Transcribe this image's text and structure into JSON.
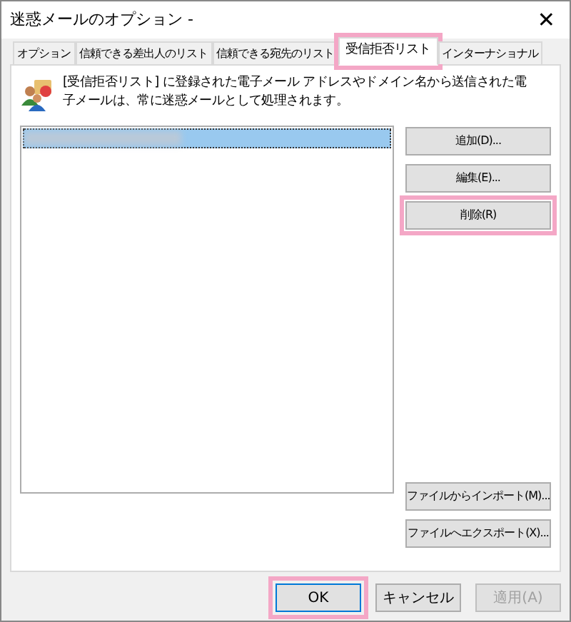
{
  "window": {
    "title": "迷惑メールのオプション -",
    "close": "✕"
  },
  "tabs": [
    {
      "label": "オプション",
      "selected": false,
      "highlighted": false
    },
    {
      "label": "信頼できる差出人のリスト",
      "selected": false,
      "highlighted": false
    },
    {
      "label": "信頼できる宛先のリスト",
      "selected": false,
      "highlighted": false
    },
    {
      "label": "受信拒否リスト",
      "selected": true,
      "highlighted": true
    },
    {
      "label": "インターナショナル",
      "selected": false,
      "highlighted": false
    }
  ],
  "description": "[受信拒否リスト] に登録された電子メール アドレスやドメイン名から送信された電子メールは、常に迷惑メールとして処理されます。",
  "list": {
    "items": [
      {
        "selected": true
      }
    ]
  },
  "side_buttons": [
    {
      "label": "追加(D)...",
      "highlighted": false
    },
    {
      "label": "編集(E)...",
      "highlighted": false
    },
    {
      "label": "削除(R)",
      "highlighted": true
    },
    {
      "label": "ファイルからインポート(M)...",
      "highlighted": false
    },
    {
      "label": "ファイルへエクスポート(X)...",
      "highlighted": false
    }
  ],
  "dialog_buttons": [
    {
      "label": "OK",
      "highlighted": true,
      "disabled": false,
      "default": true
    },
    {
      "label": "キャンセル",
      "highlighted": false,
      "disabled": false,
      "default": false
    },
    {
      "label": "適用(A)",
      "highlighted": false,
      "disabled": true,
      "default": false
    }
  ]
}
